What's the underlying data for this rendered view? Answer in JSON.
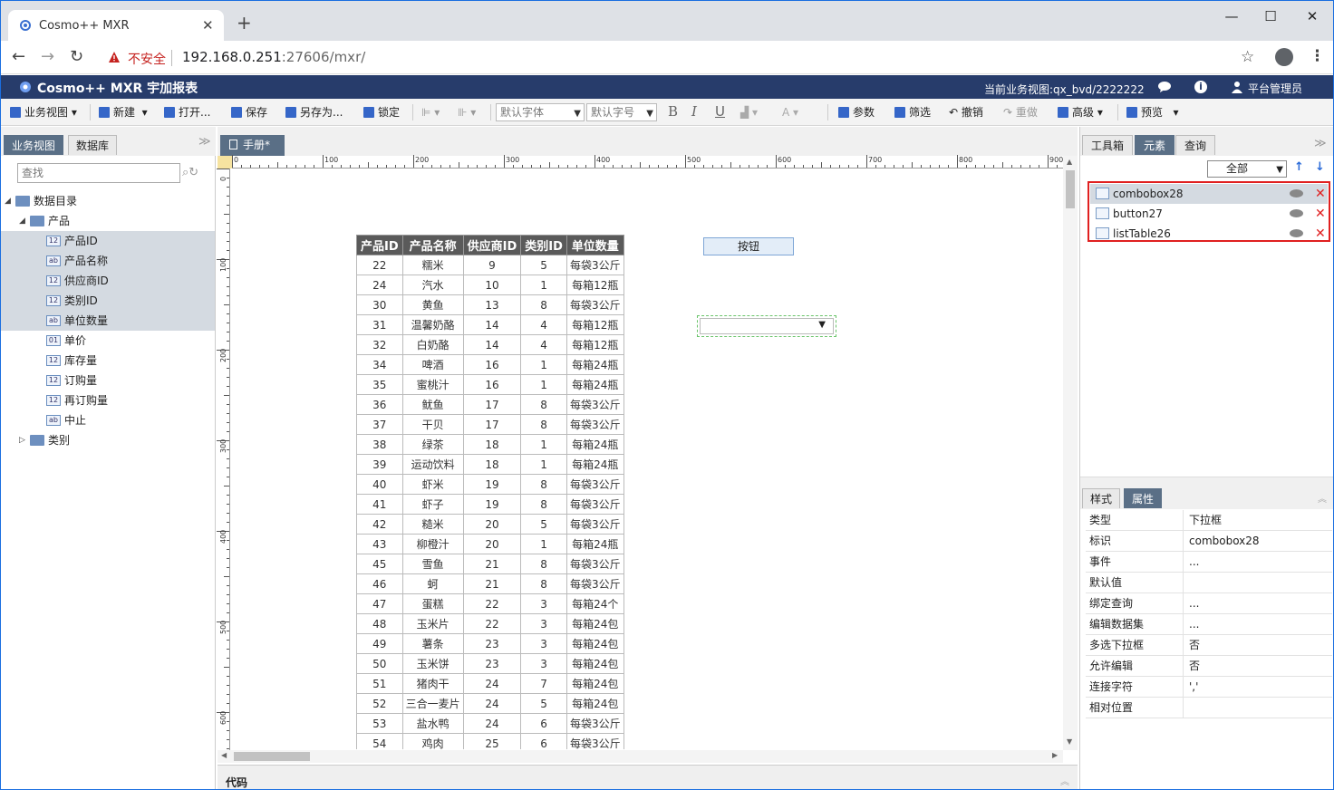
{
  "browser": {
    "tab_title": "Cosmo++ MXR",
    "tab_close": "✕",
    "new_tab": "+",
    "security_label": "不安全",
    "url_host": "192.168.0.251",
    "url_rest": ":27606/mxr/",
    "window_controls": {
      "minimize": "—",
      "maximize": "☐",
      "close": "✕"
    }
  },
  "app": {
    "title": "Cosmo++ MXR 宇加报表",
    "current_view": "当前业务视图:qx_bvd/2222222",
    "user": "平台管理员",
    "brand_color": "#273c6b"
  },
  "toolbar": {
    "business_view": "业务视图",
    "new": "新建",
    "open": "打开...",
    "save": "保存",
    "save_as": "另存为...",
    "lock": "锁定",
    "font_family": "默认字体",
    "font_size": "默认字号",
    "bold": "B",
    "italic": "I",
    "underline": "U",
    "params": "参数",
    "filter": "筛选",
    "undo": "撤销",
    "redo": "重做",
    "advanced": "高级",
    "preview": "预览"
  },
  "left_panel": {
    "tabs": [
      "业务视图",
      "数据库"
    ],
    "search_placeholder": "查找",
    "tree": [
      {
        "label": "数据目录",
        "type": "folder",
        "level": 0,
        "expanded": true
      },
      {
        "label": "产品",
        "type": "folder",
        "level": 1,
        "expanded": true
      },
      {
        "label": "产品ID",
        "type": "12",
        "level": 2,
        "highlight": true
      },
      {
        "label": "产品名称",
        "type": "ab",
        "level": 2,
        "highlight": true
      },
      {
        "label": "供应商ID",
        "type": "12",
        "level": 2,
        "highlight": true
      },
      {
        "label": "类别ID",
        "type": "12",
        "level": 2,
        "highlight": true
      },
      {
        "label": "单位数量",
        "type": "ab",
        "level": 2,
        "highlight": true
      },
      {
        "label": "单价",
        "type": "01",
        "level": 2,
        "highlight": false
      },
      {
        "label": "库存量",
        "type": "12",
        "level": 2,
        "highlight": false
      },
      {
        "label": "订购量",
        "type": "12",
        "level": 2,
        "highlight": false
      },
      {
        "label": "再订购量",
        "type": "12",
        "level": 2,
        "highlight": false
      },
      {
        "label": "中止",
        "type": "ab",
        "level": 2,
        "highlight": false
      },
      {
        "label": "类别",
        "type": "table",
        "level": 1,
        "expanded": false
      }
    ]
  },
  "center": {
    "tab_title": "手册*",
    "ruler_h": [
      "0",
      "100",
      "200",
      "300",
      "400",
      "500",
      "600",
      "700",
      "800",
      "900"
    ],
    "ruler_v": [
      "0",
      "100",
      "200",
      "300",
      "400",
      "500",
      "600"
    ],
    "button_label": "按钮",
    "code_label": "代码",
    "table": {
      "columns": [
        "产品ID",
        "产品名称",
        "供应商ID",
        "类别ID",
        "单位数量"
      ],
      "rows": [
        [
          "22",
          "糯米",
          "9",
          "5",
          "每袋3公斤"
        ],
        [
          "24",
          "汽水",
          "10",
          "1",
          "每箱12瓶"
        ],
        [
          "30",
          "黄鱼",
          "13",
          "8",
          "每袋3公斤"
        ],
        [
          "31",
          "温馨奶酪",
          "14",
          "4",
          "每箱12瓶"
        ],
        [
          "32",
          "白奶酪",
          "14",
          "4",
          "每箱12瓶"
        ],
        [
          "34",
          "啤酒",
          "16",
          "1",
          "每箱24瓶"
        ],
        [
          "35",
          "蜜桃汁",
          "16",
          "1",
          "每箱24瓶"
        ],
        [
          "36",
          "鱿鱼",
          "17",
          "8",
          "每袋3公斤"
        ],
        [
          "37",
          "干贝",
          "17",
          "8",
          "每袋3公斤"
        ],
        [
          "38",
          "绿茶",
          "18",
          "1",
          "每箱24瓶"
        ],
        [
          "39",
          "运动饮料",
          "18",
          "1",
          "每箱24瓶"
        ],
        [
          "40",
          "虾米",
          "19",
          "8",
          "每袋3公斤"
        ],
        [
          "41",
          "虾子",
          "19",
          "8",
          "每袋3公斤"
        ],
        [
          "42",
          "糙米",
          "20",
          "5",
          "每袋3公斤"
        ],
        [
          "43",
          "柳橙汁",
          "20",
          "1",
          "每箱24瓶"
        ],
        [
          "45",
          "雪鱼",
          "21",
          "8",
          "每袋3公斤"
        ],
        [
          "46",
          "蚵",
          "21",
          "8",
          "每袋3公斤"
        ],
        [
          "47",
          "蛋糕",
          "22",
          "3",
          "每箱24个"
        ],
        [
          "48",
          "玉米片",
          "22",
          "3",
          "每箱24包"
        ],
        [
          "49",
          "薯条",
          "23",
          "3",
          "每箱24包"
        ],
        [
          "50",
          "玉米饼",
          "23",
          "3",
          "每箱24包"
        ],
        [
          "51",
          "猪肉干",
          "24",
          "7",
          "每箱24包"
        ],
        [
          "52",
          "三合一麦片",
          "24",
          "5",
          "每箱24包"
        ],
        [
          "53",
          "盐水鸭",
          "24",
          "6",
          "每袋3公斤"
        ],
        [
          "54",
          "鸡肉",
          "25",
          "6",
          "每袋3公斤"
        ]
      ]
    }
  },
  "right_panel": {
    "tabs": [
      "工具箱",
      "元素",
      "查询"
    ],
    "filter_value": "全部",
    "elements": [
      "combobox28",
      "button27",
      "listTable26"
    ],
    "prop_tabs": [
      "样式",
      "属性"
    ],
    "properties": [
      {
        "key": "类型",
        "value": "下拉框"
      },
      {
        "key": "标识",
        "value": "combobox28"
      },
      {
        "key": "事件",
        "value": "..."
      },
      {
        "key": "默认值",
        "value": ""
      },
      {
        "key": "绑定查询",
        "value": "..."
      },
      {
        "key": "编辑数据集",
        "value": "..."
      },
      {
        "key": "多选下拉框",
        "value": "否"
      },
      {
        "key": "允许编辑",
        "value": "否"
      },
      {
        "key": "连接字符",
        "value": "','"
      },
      {
        "key": "相对位置",
        "value": ""
      }
    ]
  }
}
